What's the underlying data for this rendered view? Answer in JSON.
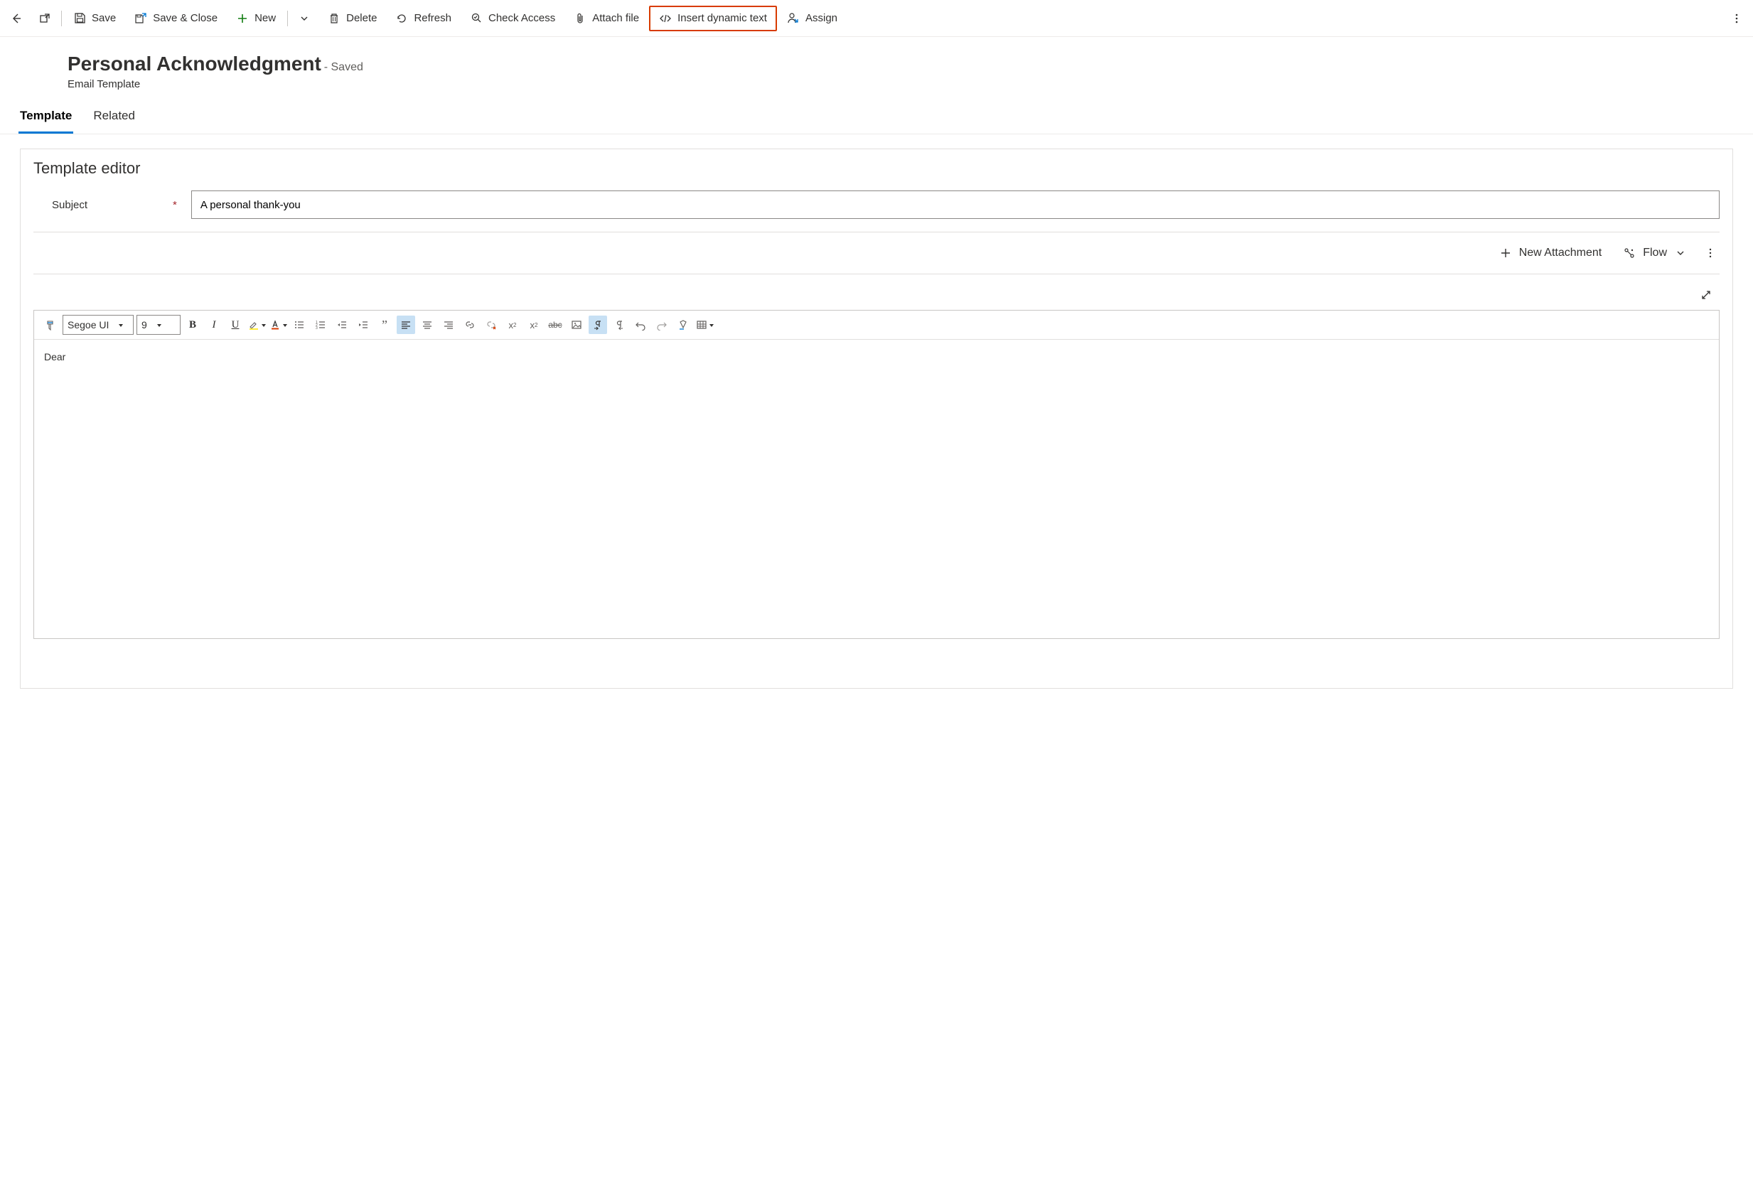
{
  "commandBar": {
    "save": "Save",
    "saveClose": "Save & Close",
    "new": "New",
    "delete": "Delete",
    "refresh": "Refresh",
    "checkAccess": "Check Access",
    "attachFile": "Attach file",
    "insertDynamic": "Insert dynamic text",
    "assign": "Assign"
  },
  "header": {
    "title": "Personal Acknowledgment",
    "statusPrefix": "- ",
    "status": "Saved",
    "subtype": "Email Template"
  },
  "tabs": {
    "template": "Template",
    "related": "Related"
  },
  "editor": {
    "sectionTitle": "Template editor",
    "subjectLabel": "Subject",
    "subjectValue": "A personal thank-you",
    "newAttachment": "New Attachment",
    "flow": "Flow",
    "fontName": "Segoe UI",
    "fontSize": "9",
    "bodyText": "Dear"
  }
}
